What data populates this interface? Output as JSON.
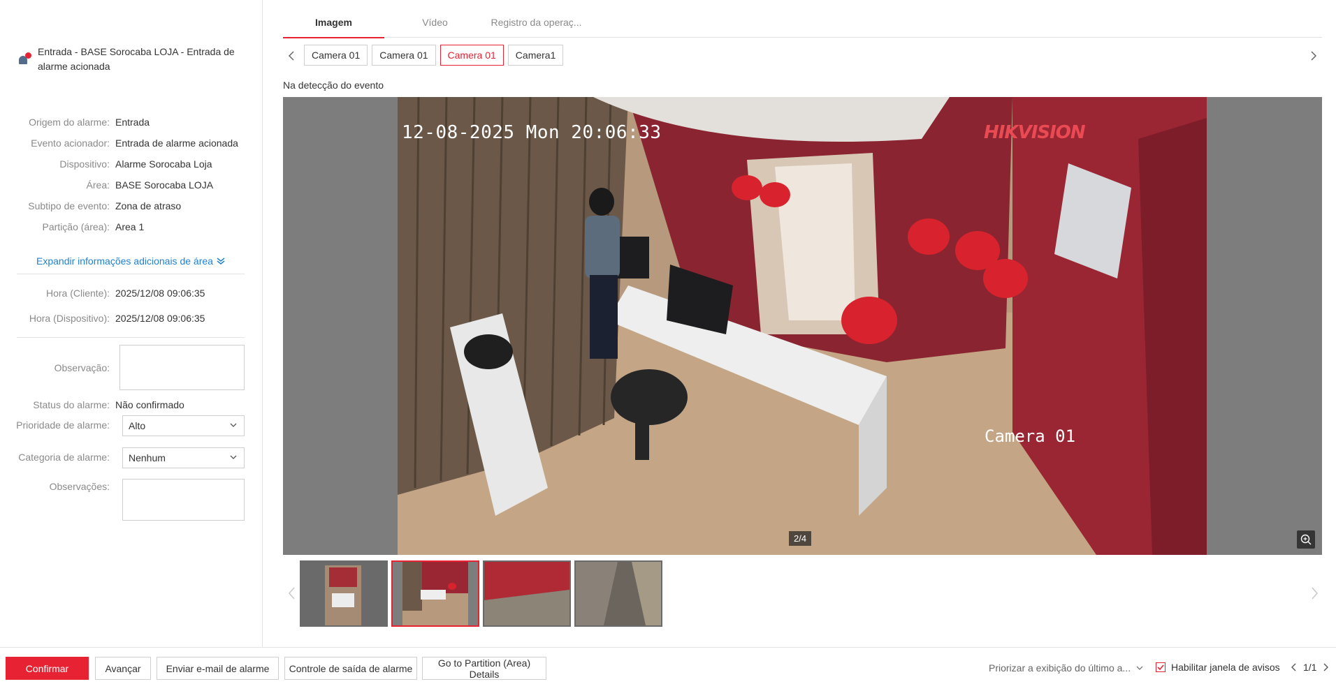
{
  "alarm": {
    "title": "Entrada - BASE Sorocaba LOJA - Entrada de alarme acionada"
  },
  "details": [
    {
      "label": "Origem do alarme:",
      "value": "Entrada"
    },
    {
      "label": "Evento acionador:",
      "value": "Entrada de alarme acionada"
    },
    {
      "label": "Dispositivo:",
      "value": "Alarme Sorocaba Loja"
    },
    {
      "label": "Área:",
      "value": "BASE Sorocaba LOJA"
    },
    {
      "label": "Subtipo de evento:",
      "value": "Zona de atraso"
    },
    {
      "label": "Partição (área):",
      "value": "Area 1"
    }
  ],
  "expand_label": "Expandir informações adicionais de área",
  "times": [
    {
      "label": "Hora (Cliente):",
      "value": "2025/12/08 09:06:35"
    },
    {
      "label": "Hora (Dispositivo):",
      "value": "2025/12/08 09:06:35"
    }
  ],
  "form": {
    "observacao_label": "Observação:",
    "status_label": "Status do alarme:",
    "status_value": "Não confirmado",
    "priority_label": "Prioridade de alarme:",
    "priority_value": "Alto",
    "category_label": "Categoria de alarme:",
    "category_value": "Nenhum",
    "observacoes_label": "Observações:"
  },
  "tabs": [
    "Imagem",
    "Vídeo",
    "Registro da operaç..."
  ],
  "camera_tabs": [
    "Camera 01",
    "Camera 01",
    "Camera 01",
    "Camera1"
  ],
  "active_camera_index": 2,
  "event_label": "Na detecção do evento",
  "viewer": {
    "timestamp": "12-08-2025 Mon 20:06:33",
    "brand": "HIKVISION",
    "camera_name": "Camera 01",
    "counter": "2/4"
  },
  "footer": {
    "confirm": "Confirmar",
    "advance": "Avançar",
    "email": "Enviar e-mail de alarme",
    "output_control": "Controle de saída de alarme",
    "partition_details": "Go to Partition (Area) Details",
    "prioritize": "Priorizar a exibição do último a...",
    "enable_popup": "Habilitar janela de avisos",
    "pager": "1/1"
  },
  "colors": {
    "accent": "#e72333",
    "link": "#1e82d2"
  }
}
